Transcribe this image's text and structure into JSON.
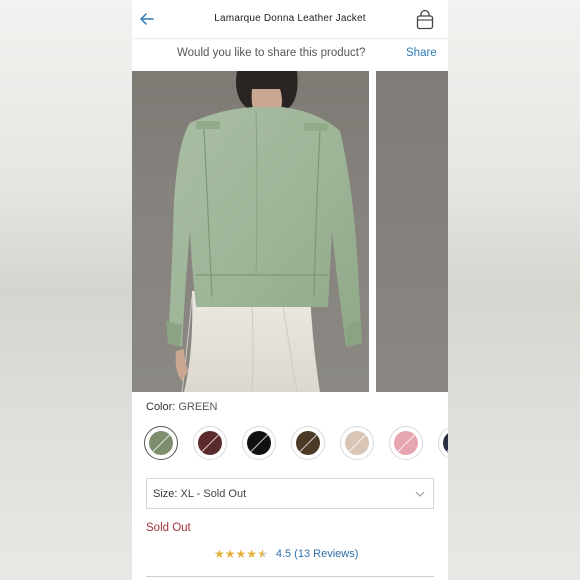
{
  "header": {
    "title": "Lamarque Donna Leather Jacket",
    "back_icon": "arrow-left-icon",
    "bag_icon": "shopping-bag-icon"
  },
  "share": {
    "question": "Would you like to share this product?",
    "link": "Share"
  },
  "color": {
    "label": "Color:",
    "value": "GREEN",
    "swatches": [
      {
        "name": "green",
        "color": "#7d8e6d",
        "selected": true
      },
      {
        "name": "burgundy",
        "color": "#5a2a2c",
        "selected": false
      },
      {
        "name": "black",
        "color": "#111111",
        "selected": false
      },
      {
        "name": "brown",
        "color": "#4a3a26",
        "selected": false
      },
      {
        "name": "beige",
        "color": "#d9c5b5",
        "selected": false
      },
      {
        "name": "pink",
        "color": "#e6a5b0",
        "selected": false
      },
      {
        "name": "navy",
        "color": "#2a3040",
        "selected": false
      }
    ]
  },
  "size": {
    "label": "Size:",
    "value": "XL - Sold Out"
  },
  "status": {
    "sold_out": "Sold Out"
  },
  "rating": {
    "value": 4.5,
    "text": "4.5 (13 Reviews)"
  },
  "colors": {
    "link": "#2f7bb5",
    "sold_out": "#a1333a",
    "star": "#e3b23c"
  }
}
